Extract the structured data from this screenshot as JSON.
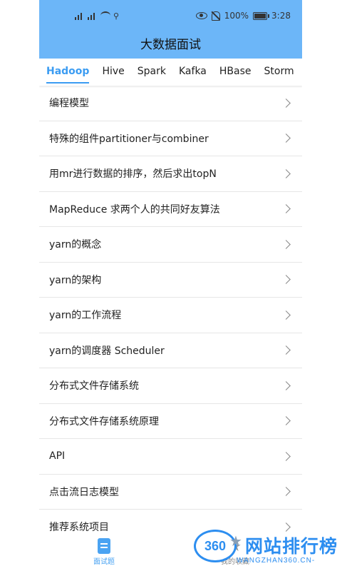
{
  "statusbar": {
    "battery": "100%",
    "time": "3:28"
  },
  "app": {
    "title": "大数据面试"
  },
  "tabs": [
    {
      "label": "Hadoop",
      "active": true
    },
    {
      "label": "Hive"
    },
    {
      "label": "Spark"
    },
    {
      "label": "Kafka"
    },
    {
      "label": "HBase"
    },
    {
      "label": "Storm"
    }
  ],
  "list": [
    "编程模型",
    "特殊的组件partitioner与combiner",
    "用mr进行数据的排序，然后求出topN",
    "MapReduce 求两个人的共同好友算法",
    "yarn的概念",
    "yarn的架构",
    "yarn的工作流程",
    "yarn的调度器 Scheduler",
    "分布式文件存储系统",
    "分布式文件存储系统原理",
    "API",
    "点击流日志模型",
    "推荐系统项目"
  ],
  "bottomnav": [
    {
      "label": "面试题",
      "icon": "document-icon",
      "active": true
    },
    {
      "label": "我的收藏",
      "icon": "star-icon"
    }
  ],
  "watermark": {
    "logo": "360",
    "text": "网站排行榜",
    "sub": "WANGZHAN360.CN-"
  },
  "colors": {
    "appbar": "#6cb6f8",
    "accent": "#3b9cf2"
  }
}
